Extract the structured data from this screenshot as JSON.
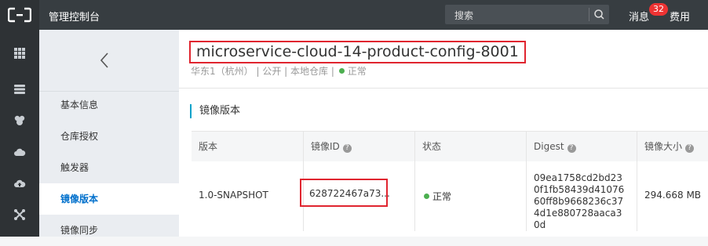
{
  "topbar": {
    "title": "管理控制台",
    "search_placeholder": "搜索",
    "messages_label": "消息",
    "messages_count": "32",
    "fees_label": "费用"
  },
  "rail": {
    "icons": [
      "grid-icon",
      "database-icon",
      "flower-icon",
      "cloud-icon",
      "cloud-upload-icon",
      "cross-arrows-icon"
    ]
  },
  "sidebar": {
    "items": [
      {
        "label": "基本信息",
        "active": false
      },
      {
        "label": "仓库授权",
        "active": false
      },
      {
        "label": "触发器",
        "active": false
      },
      {
        "label": "镜像版本",
        "active": true
      },
      {
        "label": "镜像同步",
        "active": false
      }
    ]
  },
  "repo": {
    "name": "microservice-cloud-14-product-config-8001",
    "region": "华东1（杭州）",
    "visibility": "公开",
    "type": "本地仓库",
    "status": "正常"
  },
  "section": {
    "title": "镜像版本"
  },
  "table": {
    "headers": [
      "版本",
      "镜像ID",
      "状态",
      "Digest",
      "镜像大小"
    ],
    "rows": [
      {
        "version": "1.0-SNAPSHOT",
        "image_id": "628722467a73...",
        "status": "正常",
        "digest": "09ea1758cd2bd230f1fb58439d4107660ff8b9668236c374d1e880728aaca30d",
        "size": "294.668 MB"
      }
    ]
  },
  "colors": {
    "topbar": "#373d41",
    "accent": "#0070cc",
    "highlight": "#e0252f",
    "ok": "#4caf50"
  }
}
